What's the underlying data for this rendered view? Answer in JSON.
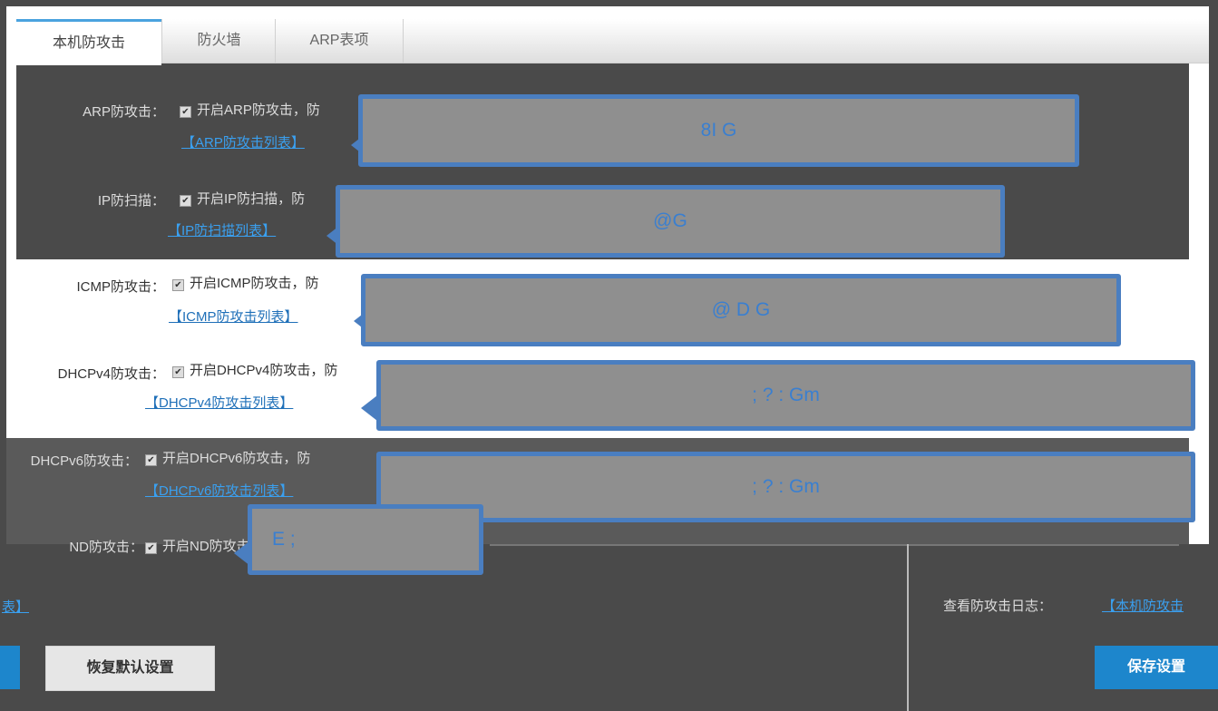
{
  "tabs": [
    {
      "label": "本机防攻击",
      "active": true
    },
    {
      "label": "防火墙",
      "active": false
    },
    {
      "label": "ARP表项",
      "active": false
    }
  ],
  "rows": [
    {
      "label": "ARP防攻击：",
      "checkbox_text": "开启ARP防攻击，防",
      "link": "【ARP防攻击列表】",
      "callout": "8I G"
    },
    {
      "label": "IP防扫描：",
      "checkbox_text": "开启IP防扫描，防",
      "link": "【IP防扫描列表】",
      "callout": "@G"
    },
    {
      "label": "ICMP防攻击：",
      "checkbox_text": "开启ICMP防攻击，防",
      "link": "【ICMP防攻击列表】",
      "callout": "@ D G"
    },
    {
      "label": "DHCPv4防攻击：",
      "checkbox_text": "开启DHCPv4防攻击，防",
      "link": "【DHCPv4防攻击列表】",
      "callout": "; ? : Gm"
    },
    {
      "label": "DHCPv6防攻击：",
      "checkbox_text": "开启DHCPv6防攻击，防",
      "link": "【DHCPv6防攻击列表】",
      "callout": "; ? : Gm"
    },
    {
      "label": "ND防攻击：",
      "checkbox_text": "开启ND防攻击，防",
      "callout": "E ;"
    }
  ],
  "footer": {
    "left_link": "表】",
    "log_label": "查看防攻击日志：",
    "log_link": "【本机防攻击"
  },
  "buttons": {
    "restore_default": "恢复默认设置",
    "save": "保存设置"
  },
  "colors": {
    "accent": "#1d86cc",
    "callout_border": "#4a7ec0",
    "callout_fill": "#8f8f8f",
    "link": "#1e6fb8"
  }
}
